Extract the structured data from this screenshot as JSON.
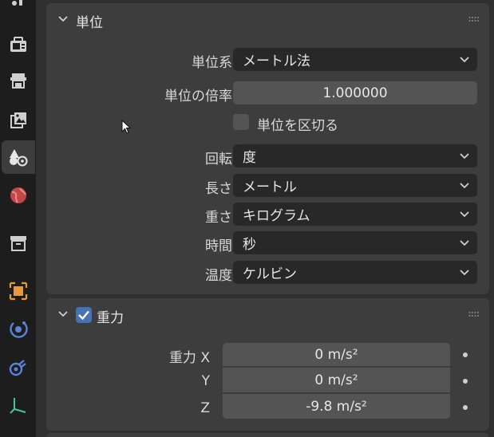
{
  "tabs": [
    {
      "name": "output-icon",
      "active": false
    },
    {
      "name": "view-layer-icon",
      "active": false
    },
    {
      "name": "image-icon",
      "active": false
    },
    {
      "name": "scene-icon",
      "active": true
    },
    {
      "name": "world-icon",
      "active": false
    },
    {
      "name": "collection-icon",
      "active": false
    },
    {
      "name": "object-icon",
      "active": false
    },
    {
      "name": "physics-icon",
      "active": false
    },
    {
      "name": "constraints-icon",
      "active": false
    },
    {
      "name": "data-icon",
      "active": false
    }
  ],
  "units_panel": {
    "title": "単位",
    "unit_system": {
      "label": "単位系",
      "value": "メートル法"
    },
    "unit_scale": {
      "label": "単位の倍率",
      "value": "1.000000"
    },
    "separate_units": {
      "label": "単位を区切る",
      "checked": false
    },
    "rotation": {
      "label": "回転",
      "value": "度"
    },
    "length": {
      "label": "長さ",
      "value": "メートル"
    },
    "mass": {
      "label": "重さ",
      "value": "キログラム"
    },
    "time": {
      "label": "時間",
      "value": "秒"
    },
    "temperature": {
      "label": "温度",
      "value": "ケルビン"
    }
  },
  "gravity_panel": {
    "title": "重力",
    "checked": true,
    "x": {
      "label": "重力 X",
      "value": "0 m/s²"
    },
    "y": {
      "label": "Y",
      "value": "0 m/s²"
    },
    "z": {
      "label": "Z",
      "value": "-9.8 m/s²"
    }
  },
  "colors": {
    "accent": "#4772b3",
    "panel_bg": "#3d3d3d",
    "editor_bg": "#303030"
  }
}
